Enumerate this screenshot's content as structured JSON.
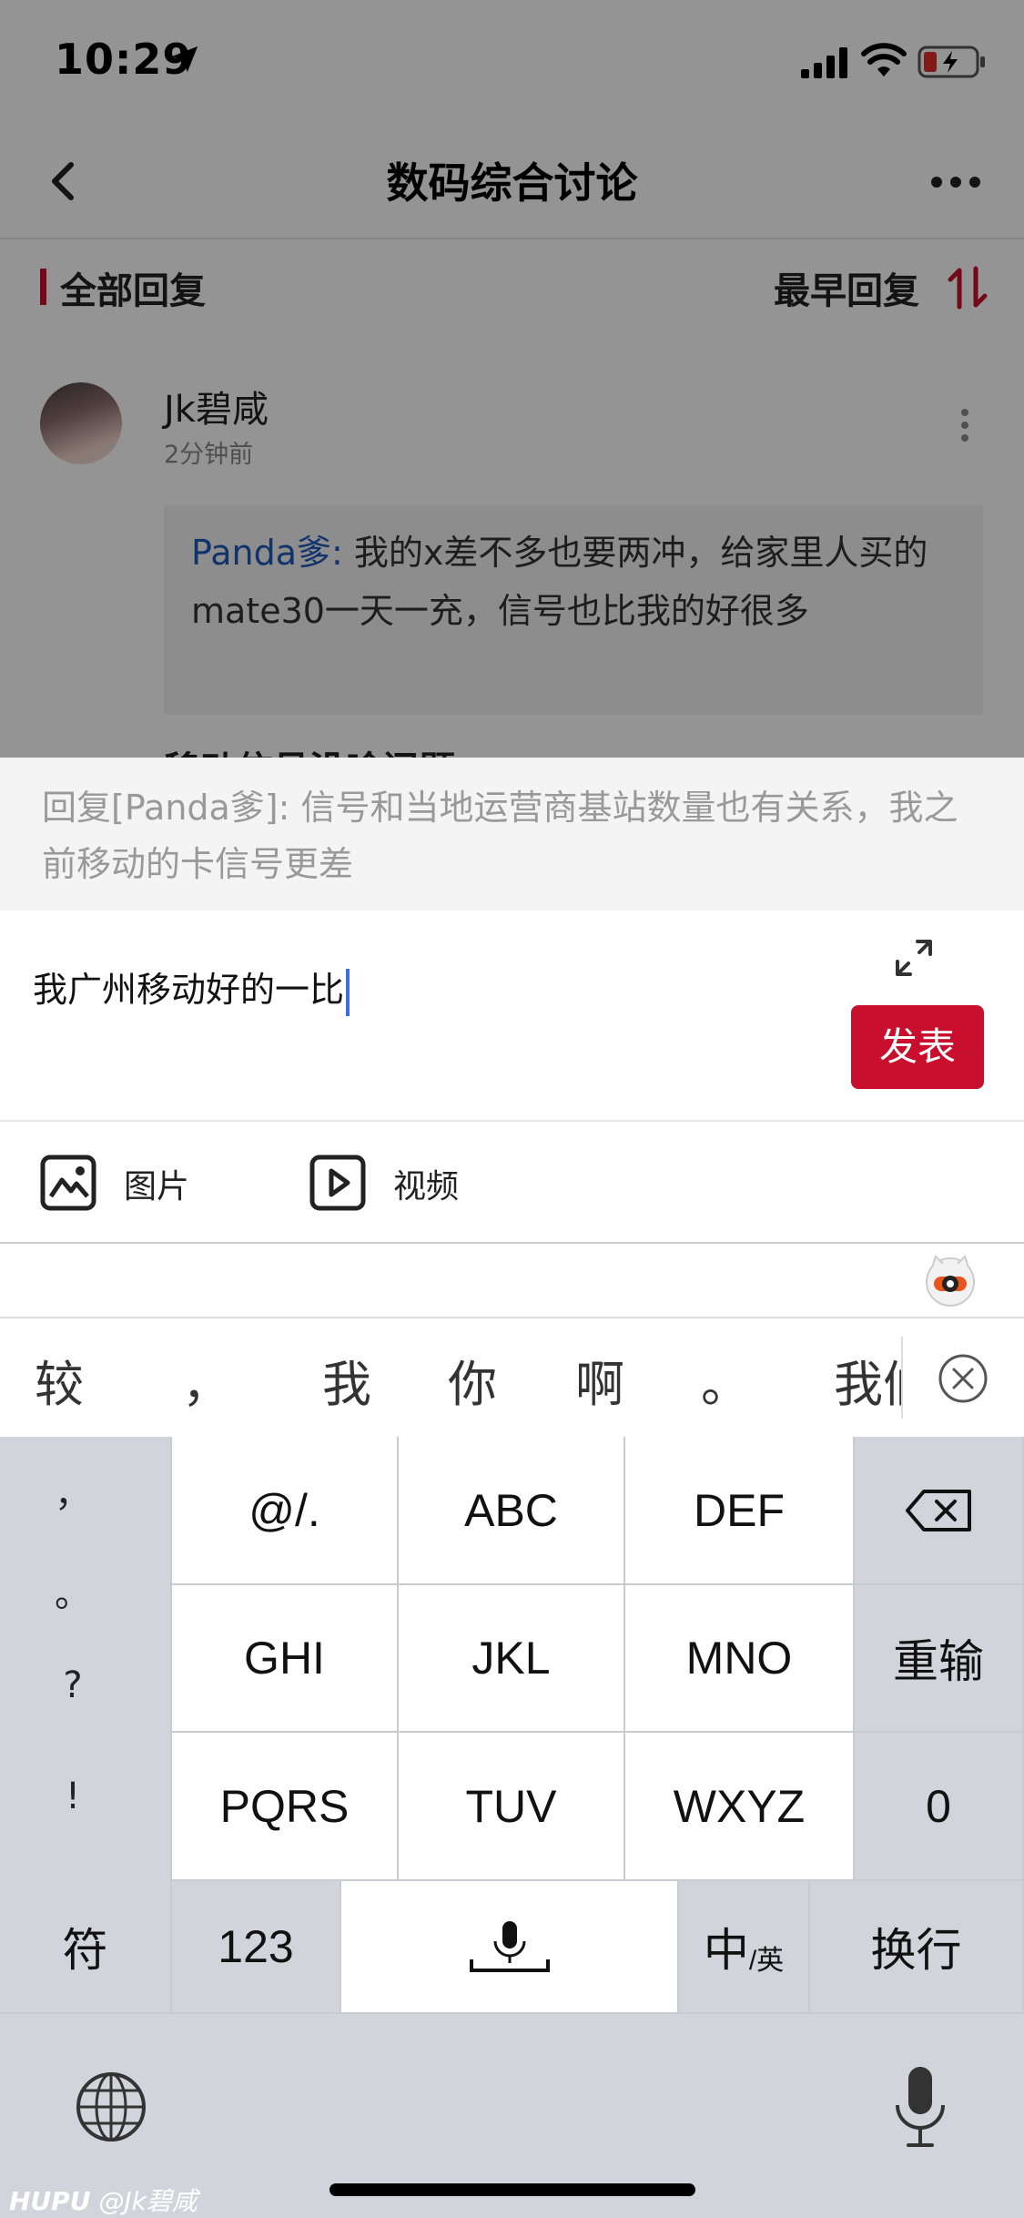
{
  "status_bar": {
    "time": "10:29"
  },
  "nav": {
    "title": "数码综合讨论"
  },
  "reply_header": {
    "all_replies": "全部回复",
    "sort": "最早回复"
  },
  "comment": {
    "username": "Jk碧咸",
    "time_ago": "2分钟前",
    "quote_author": "Panda爹:",
    "quote_text": " 我的x差不多也要两冲，给家里人买的mate30一天一充，信号也比我的好很多",
    "cut_text": "移动信号没啥问题"
  },
  "reply_hint": "回复[Panda爹]: 信号和当地运营商基站数量也有关系，我之前移动的卡信号更差",
  "composer": {
    "input_value": "我广州移动好的一比",
    "post_label": "发表"
  },
  "attachments": {
    "image_label": "图片",
    "video_label": "视频"
  },
  "keyboard": {
    "candidates": [
      "较",
      "，",
      "我",
      "你",
      "啊",
      "。",
      "我们"
    ],
    "punctuation": [
      "，",
      "。",
      "?",
      "!"
    ],
    "rows": [
      [
        "@/.",
        "ABC",
        "DEF"
      ],
      [
        "GHI",
        "JKL",
        "MNO",
        "重输"
      ],
      [
        "PQRS",
        "TUV",
        "WXYZ",
        "0"
      ]
    ],
    "bottom": {
      "symbols": "符",
      "numbers": "123",
      "lang_main": "中",
      "lang_sub": "/英",
      "enter": "换行"
    }
  },
  "watermark": {
    "brand": "HUPU",
    "user": "@Jk碧咸"
  },
  "colors": {
    "accent": "#c8102e",
    "link": "#1e59b8",
    "keyboard_bg": "#d1d4da"
  }
}
